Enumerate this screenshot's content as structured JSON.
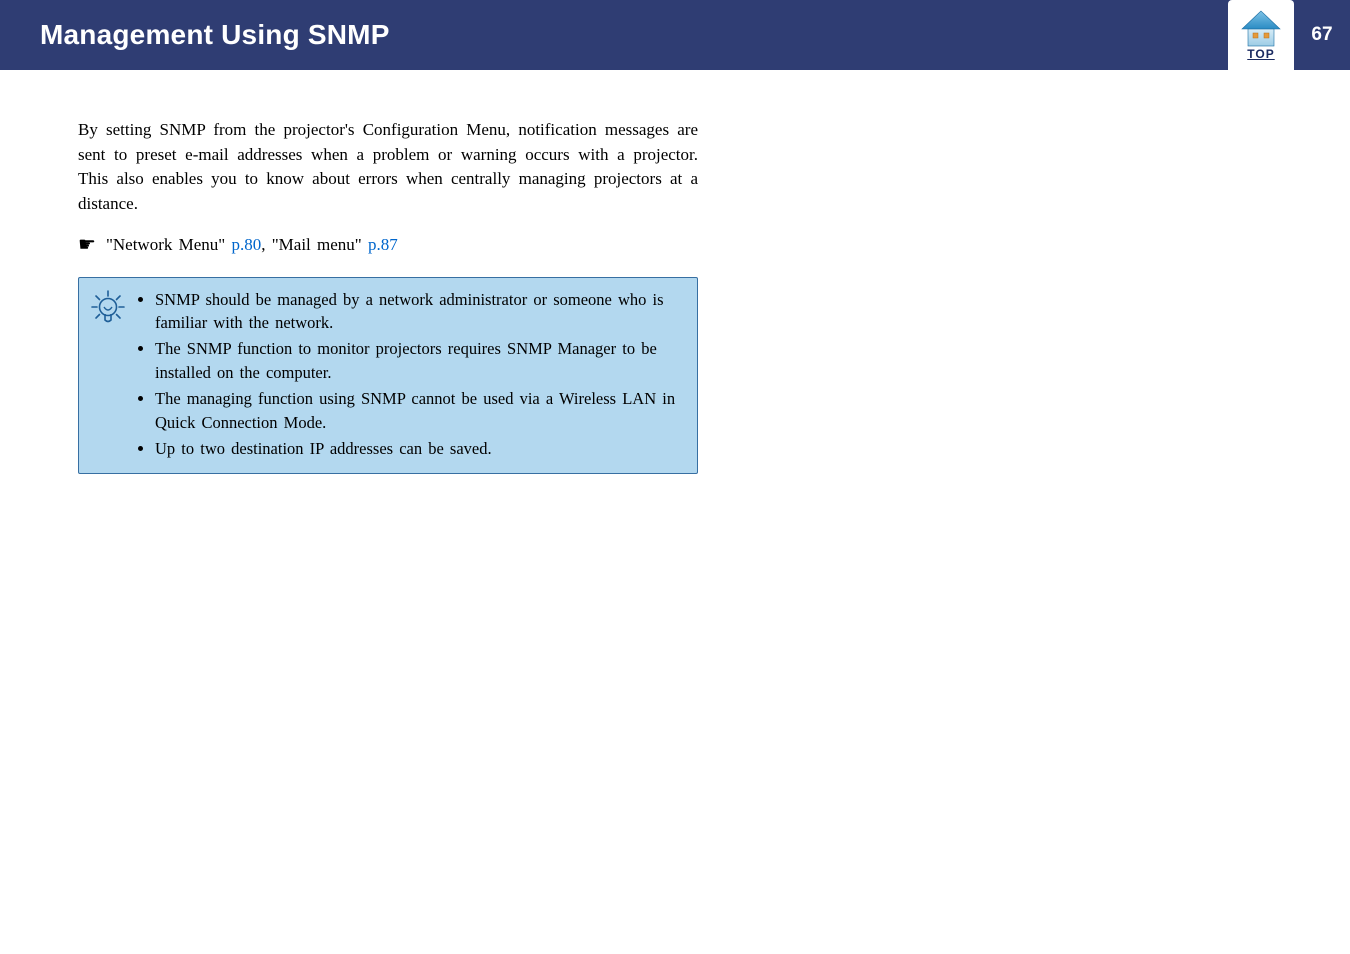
{
  "header": {
    "title": "Management Using SNMP",
    "top_label": "TOP",
    "page_number": "67"
  },
  "body": {
    "paragraph": "By setting SNMP from the projector's Configuration Menu, notification messages are sent to preset e-mail addresses when a problem or warning occurs with a projector. This also enables you to know about errors when centrally managing projectors at a distance.",
    "see_prefix": "\"Network Menu\" ",
    "see_link1": "p.80",
    "see_mid": ", \"Mail menu\" ",
    "see_link2": "p.87"
  },
  "tips": {
    "items": [
      "SNMP should be managed by a network administrator or someone who is familiar with the network.",
      "The SNMP function to monitor projectors requires SNMP Manager to be installed on the computer.",
      "The managing function using SNMP cannot be used via a Wireless LAN in Quick Connection Mode.",
      "Up to two destination IP addresses can be saved."
    ]
  }
}
